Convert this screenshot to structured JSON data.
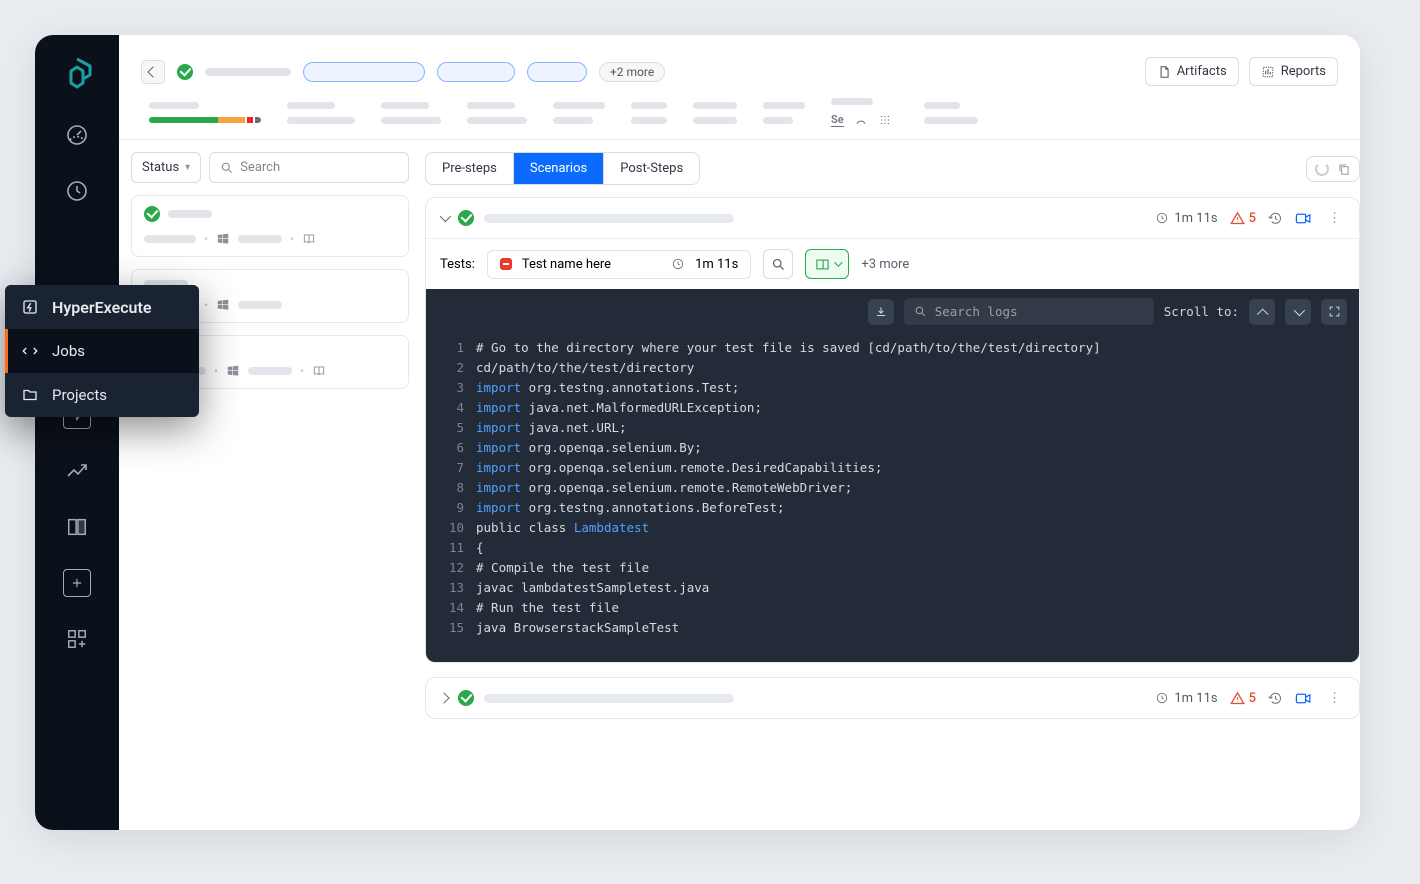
{
  "flyout": {
    "title": "HyperExecute",
    "items": [
      {
        "label": "Jobs",
        "active": true
      },
      {
        "label": "Projects",
        "active": false
      }
    ]
  },
  "topbar": {
    "more_chip": "+2 more",
    "artifacts_label": "Artifacts",
    "reports_label": "Reports"
  },
  "left_panel": {
    "status_label": "Status",
    "search_placeholder": "Search"
  },
  "tabs": {
    "pre": "Pre-steps",
    "scenarios": "Scenarios",
    "post": "Post-Steps"
  },
  "scenario1": {
    "duration": "1m 11s",
    "warn_count": "5"
  },
  "tests": {
    "label": "Tests:",
    "test_name": "Test name here",
    "duration": "1m 11s",
    "more": "+3 more"
  },
  "code_toolbar": {
    "search_placeholder": "Search logs",
    "scroll_label": "Scroll to:"
  },
  "code": [
    {
      "n": 1,
      "plain": "# Go to the directory where your test file is saved [cd/path/to/the/test/directory]"
    },
    {
      "n": 2,
      "plain": "cd/path/to/the/test/directory"
    },
    {
      "n": 3,
      "kw": "import",
      "rest": " org.testng.annotations.Test;"
    },
    {
      "n": 4,
      "kw": "import",
      "rest": " java.net.MalformedURLException;"
    },
    {
      "n": 5,
      "kw": "import",
      "rest": " java.net.URL;"
    },
    {
      "n": 6,
      "kw": "import",
      "rest": " org.openqa.selenium.By;"
    },
    {
      "n": 7,
      "kw": "import",
      "rest": " org.openqa.selenium.remote.DesiredCapabilities;"
    },
    {
      "n": 8,
      "kw": "import",
      "rest": " org.openqa.selenium.remote.RemoteWebDriver;"
    },
    {
      "n": 9,
      "kw": "import",
      "rest": " org.testng.annotations.BeforeTest;"
    },
    {
      "n": 10,
      "plain_pre": "public class ",
      "cls": "Lambdatest"
    },
    {
      "n": 11,
      "plain": "{"
    },
    {
      "n": 12,
      "plain": "# Compile the test file"
    },
    {
      "n": 13,
      "plain": "javac lambdatestSampletest.java"
    },
    {
      "n": 14,
      "plain": "# Run the test file"
    },
    {
      "n": 15,
      "plain": "java BrowserstackSampleTest"
    }
  ],
  "scenario2": {
    "duration": "1m 11s",
    "warn_count": "5"
  }
}
